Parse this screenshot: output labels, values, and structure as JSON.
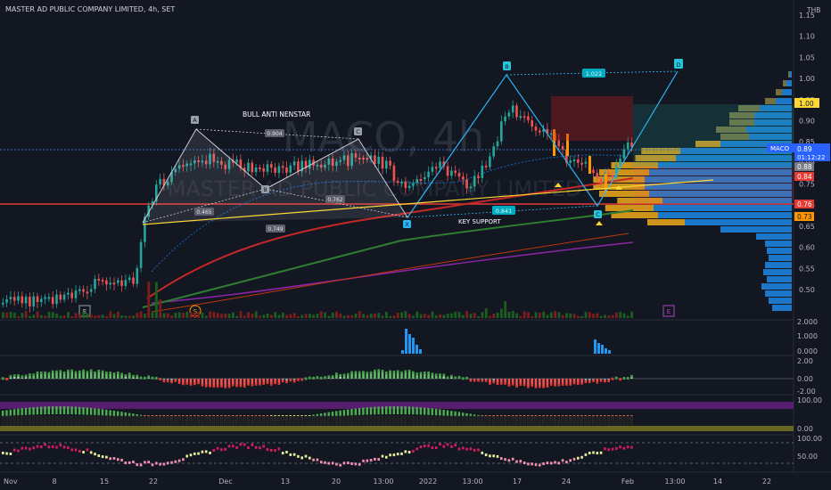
{
  "header": {
    "title": "MASTER AD PUBLIC COMPANY LIMITED, 4h, SET",
    "currency": "THB",
    "watermark": "MACO, 4h",
    "watermark_sub": "MASTER AD PUBLIC COMPANY LIMITED"
  },
  "annotations": {
    "bull_anti_nenstar": "BULL ANTI NENSTAR",
    "key_support": "KEY SUPPORT",
    "pt_A": "A",
    "pt_B": "B",
    "pt_C": "C",
    "pt_D": "D",
    "pt_X": "X",
    "ratio_1": "0.904",
    "ratio_2": "0.762",
    "ratio_3": "0.465",
    "ratio_4": "0.749",
    "ratio_5": "1.022",
    "ratio_6": "0.841",
    "event_E1": "E",
    "event_S": "S",
    "event_E2": "E"
  },
  "price_axis": {
    "ticks": [
      "1.15",
      "1.10",
      "1.05",
      "1.00",
      "0.95",
      "0.90",
      "0.85",
      "0.80",
      "0.75",
      "0.70",
      "0.65",
      "0.60",
      "0.55",
      "0.50"
    ],
    "symbol_tag": "MACO",
    "last_price": "0.89",
    "countdown": "01:12:22",
    "tag_100": "1.00",
    "tag_088": "0.88",
    "tag_084": "0.84",
    "tag_076": "0.76",
    "tag_073": "0.73"
  },
  "volume_axis": {
    "ticks": [
      "2.000",
      "1.000",
      "0.000"
    ]
  },
  "osc1_axis": {
    "ticks": [
      "2.00",
      "0.00",
      "-2.00"
    ]
  },
  "osc2_axis": {
    "ticks": [
      "100.00",
      "0.00"
    ]
  },
  "osc3_axis": {
    "ticks": [
      "100.00",
      "50.00"
    ]
  },
  "time_axis": {
    "labels": [
      "Nov",
      "8",
      "15",
      "22",
      "Dec",
      "13",
      "20",
      "13:00",
      "2022",
      "13:00",
      "17",
      "24",
      "Feb",
      "13:00",
      "14",
      "22"
    ]
  },
  "colors": {
    "up": "#26a69a",
    "down": "#ef5350",
    "bg": "#131722",
    "harmonic": "#c9ccd4",
    "pattern_cyan": "#29b6f6",
    "support": "#fdd835",
    "red_line": "#e53935",
    "ema_green": "#2e7d32",
    "profile_blue": "#1e88e5",
    "profile_orange": "#e3a11b",
    "magenta": "#8e24aa",
    "osc_magenta": "#d81b60"
  }
}
